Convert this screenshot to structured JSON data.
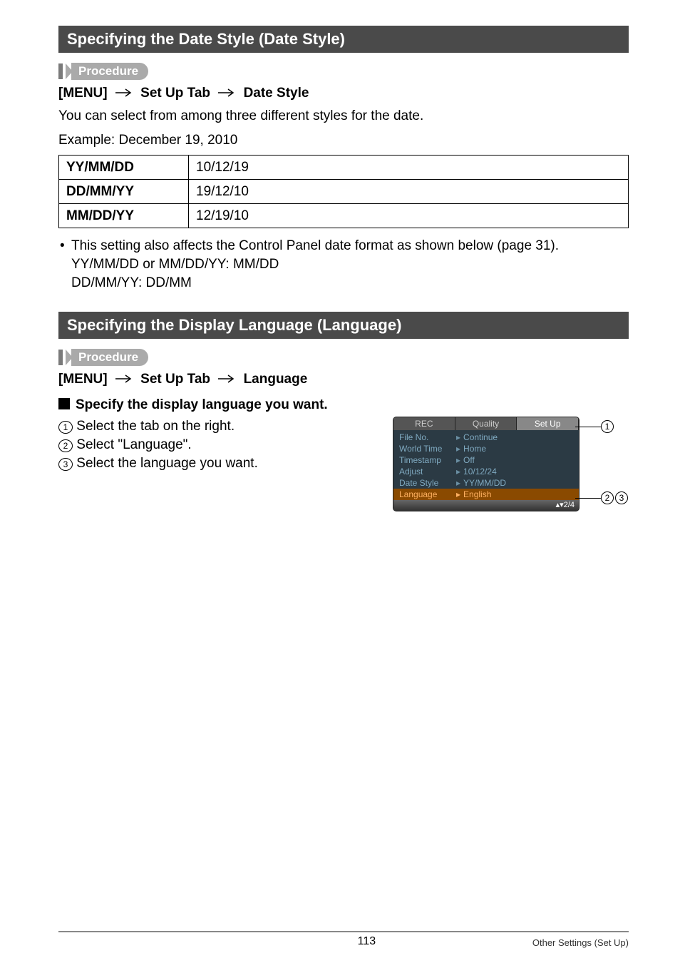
{
  "sections": {
    "dateStyle": {
      "title": "Specifying the Date Style (Date Style)",
      "procedureLabel": "Procedure",
      "breadcrumb": {
        "a": "[MENU]",
        "b": "Set Up Tab",
        "c": "Date Style"
      },
      "intro1": "You can select from among three different styles for the date.",
      "intro2": "Example: December 19, 2010",
      "table": {
        "rows": [
          {
            "label": "YY/MM/DD",
            "value": "10/12/19"
          },
          {
            "label": "DD/MM/YY",
            "value": "19/12/10"
          },
          {
            "label": "MM/DD/YY",
            "value": "12/19/10"
          }
        ]
      },
      "note": {
        "line1": "This setting also affects the Control Panel date format as shown below (page 31).",
        "line2": "YY/MM/DD or MM/DD/YY: MM/DD",
        "line3": "DD/MM/YY: DD/MM"
      }
    },
    "language": {
      "title": "Specifying the Display Language (Language)",
      "procedureLabel": "Procedure",
      "breadcrumb": {
        "a": "[MENU]",
        "b": "Set Up Tab",
        "c": "Language"
      },
      "subhead": "Specify the display language you want.",
      "steps": {
        "s1": "Select the tab on the right.",
        "s2": "Select \"Language\".",
        "s3": "Select the language you want."
      },
      "callouts": {
        "c1": "1",
        "c2": "2",
        "c3": "3"
      },
      "shot": {
        "tabs": {
          "rec": "REC",
          "quality": "Quality",
          "setup": "Set Up"
        },
        "rows": [
          {
            "label": "File No.",
            "value": "Continue"
          },
          {
            "label": "World Time",
            "value": "Home"
          },
          {
            "label": "Timestamp",
            "value": "Off"
          },
          {
            "label": "Adjust",
            "value": "10/12/24"
          },
          {
            "label": "Date Style",
            "value": "YY/MM/DD"
          },
          {
            "label": "Language",
            "value": "English",
            "highlight": true
          }
        ],
        "pager": "2/4"
      }
    }
  },
  "footer": {
    "page": "113",
    "chapter": "Other Settings (Set Up)"
  }
}
